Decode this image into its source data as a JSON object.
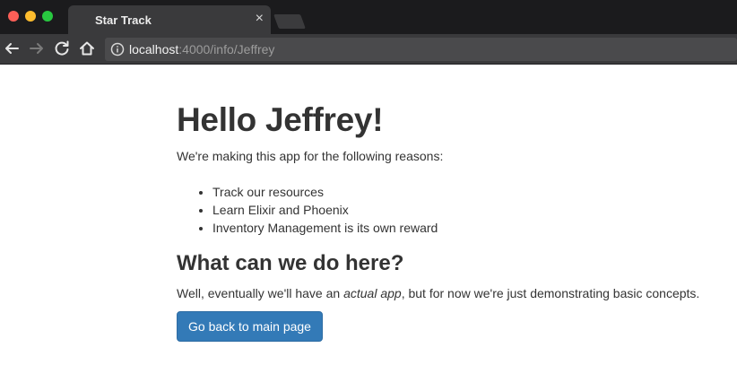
{
  "browser": {
    "tab_title": "Star Track",
    "tab_close": "×",
    "url_host": "localhost",
    "url_path": ":4000/info/Jeffrey"
  },
  "page": {
    "heading": "Hello Jeffrey!",
    "intro": "We're making this app for the following reasons:",
    "reasons": [
      "Track our resources",
      "Learn Elixir and Phoenix",
      "Inventory Management is its own reward"
    ],
    "subheading": "What can we do here?",
    "description": {
      "before": "Well, eventually we'll have an ",
      "emphasis": "actual app",
      "after": ", but for now we're just demonstrating basic concepts."
    },
    "button_label": "Go back to main page"
  },
  "colors": {
    "primary_button": "#337ab7",
    "text": "#333333"
  }
}
